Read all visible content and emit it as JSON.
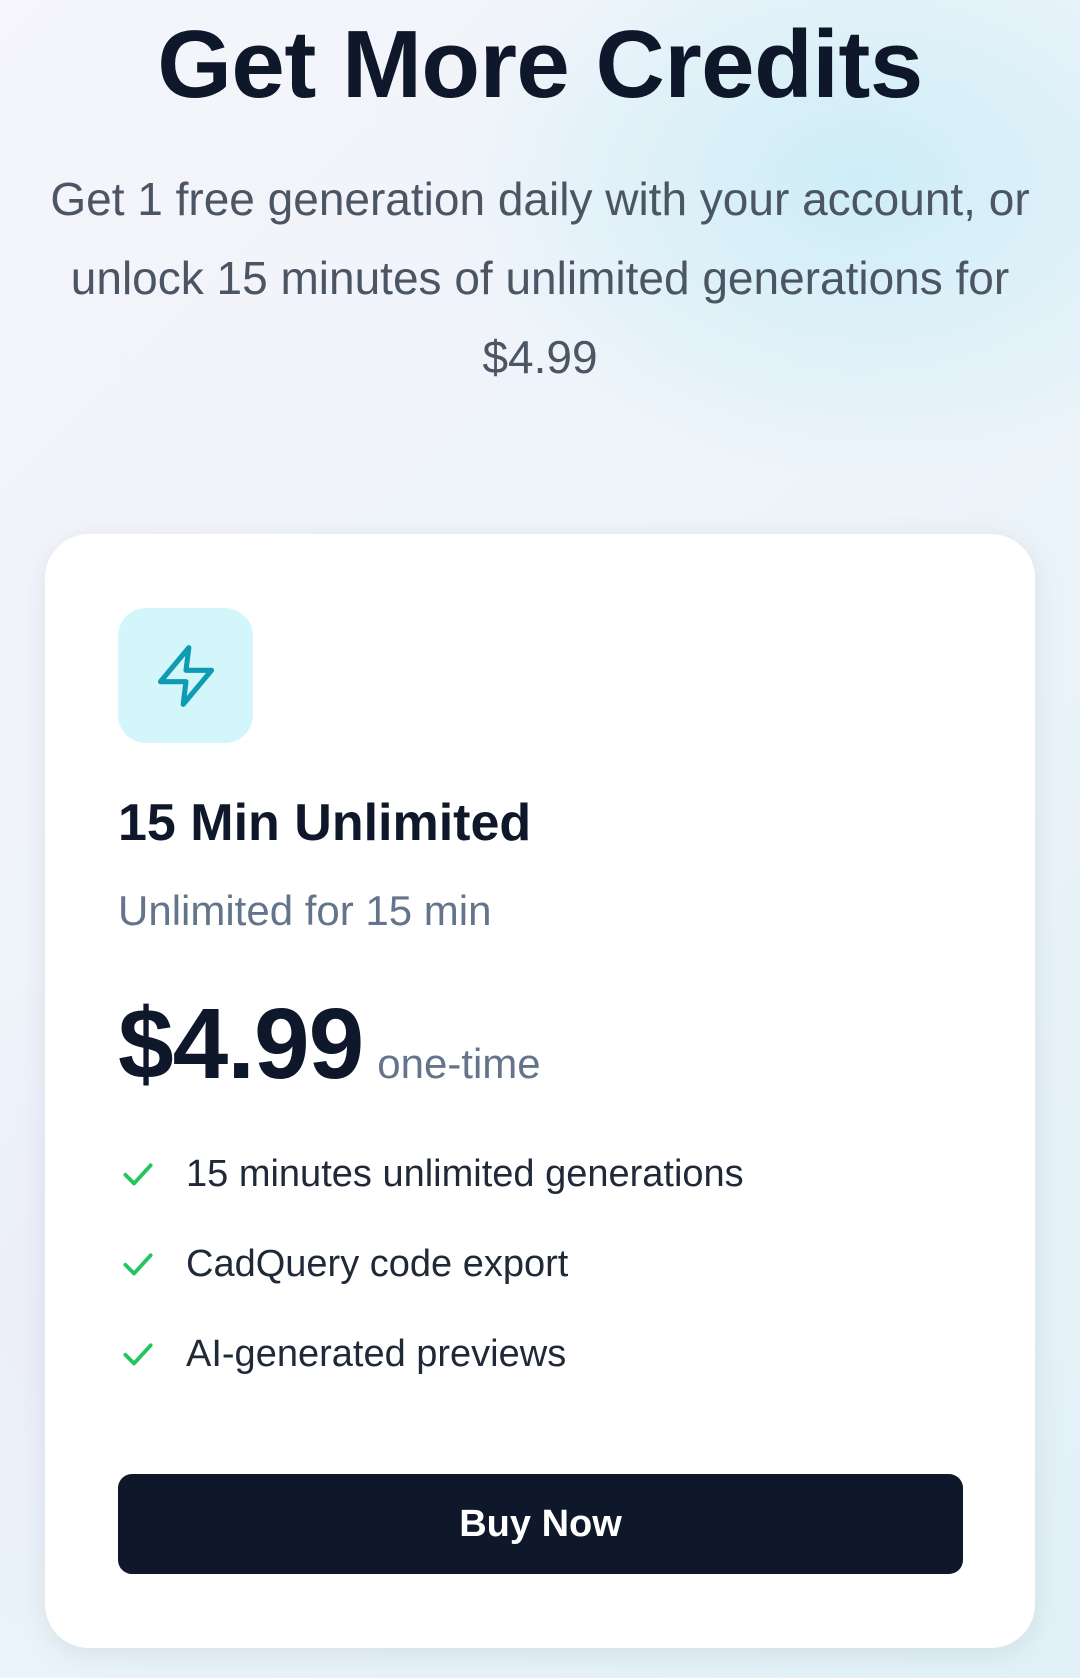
{
  "header": {
    "title": "Get More Credits",
    "subtitle": "Get 1 free generation daily with your account, or unlock 15 minutes of unlimited generations for $4.99"
  },
  "plan": {
    "icon": "lightning-bolt-icon",
    "name": "15 Min Unlimited",
    "description": "Unlimited for 15 min",
    "price": "$4.99",
    "price_note": "one-time",
    "features": [
      "15 minutes unlimited generations",
      "CadQuery code export",
      "AI-generated previews"
    ],
    "button_label": "Buy Now"
  },
  "colors": {
    "accent": "#0e9bb3",
    "icon_tile_bg": "#d3f6fa",
    "check": "#22c55e",
    "button_bg": "#0f172a",
    "text_primary": "#0f172a",
    "text_muted": "#64748b"
  }
}
